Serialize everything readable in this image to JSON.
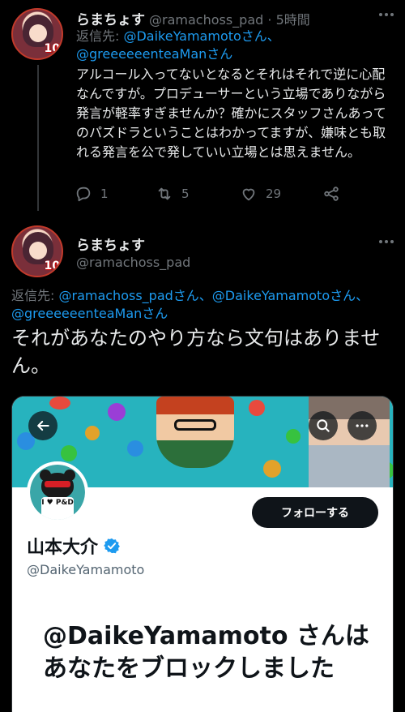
{
  "tweet1": {
    "display_name": "らまちょす",
    "handle": "@ramachoss_pad",
    "time": "· 5時間",
    "reply_prefix": "返信先: ",
    "reply_user1": "@DaikeYamamoto",
    "reply_suffix1": "さん、",
    "reply_user2": "@greeeeeenteaMan",
    "reply_suffix2": "さん",
    "body": "アルコール入ってないとなるとそれはそれで逆に心配なんですが。プロデューサーという立場でありながら発言が軽率すぎませんか？確かにスタッフさんあってのパズドラということはわかってますが、嫌味とも取れる発言を公で発していい立場とは思えません。",
    "reply_count": "1",
    "retweet_count": "5",
    "like_count": "29",
    "avatar_badge": "10"
  },
  "tweet2": {
    "display_name": "らまちょす",
    "handle": "@ramachoss_pad",
    "reply_prefix": "返信先: ",
    "reply_user1": "@ramachoss_pad",
    "reply_suffix1": "さん、",
    "reply_user2": "@DaikeYamamoto",
    "reply_suffix2": "さん、",
    "reply_user3": "@greeeeeenteaMan",
    "reply_suffix3": "さん",
    "body": "それがあなたのやり方なら文句はありません。",
    "avatar_badge": "10"
  },
  "embedded_profile": {
    "follow_label": "フォローする",
    "profile_name": "山本大介",
    "profile_handle": "@DaikeYamamoto",
    "blocked_message": "@DaikeYamamoto さんはあなたをブロックしました",
    "shirt_text": "I ♥ P&D"
  },
  "icons": [
    "more-horizontal-icon",
    "reply-icon",
    "retweet-icon",
    "like-icon",
    "share-icon",
    "back-arrow-icon",
    "search-icon",
    "verified-icon"
  ],
  "colors": {
    "background": "#000000",
    "link": "#1d9bf0",
    "muted": "#71767b",
    "banner": "#27b3be",
    "verified": "#1d9bf0"
  }
}
